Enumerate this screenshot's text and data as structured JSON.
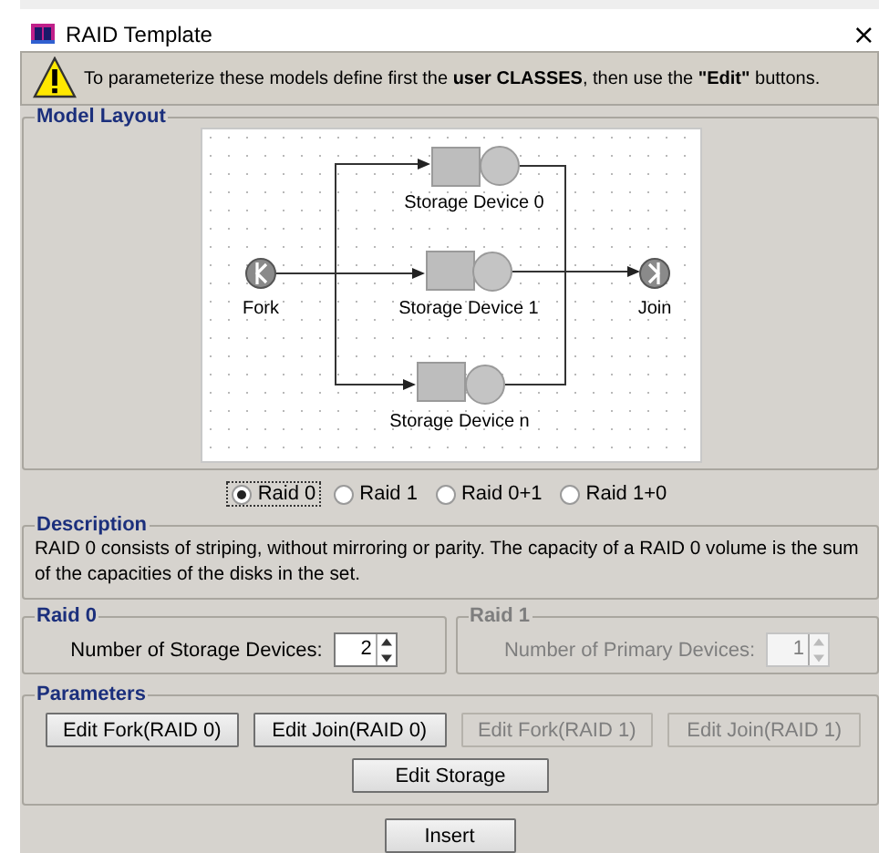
{
  "window": {
    "title": "RAID Template",
    "close": "×"
  },
  "notice": {
    "text": "To parameterize these models define first the **user CLASSES**, then use the **\"Edit\"** buttons."
  },
  "model_layout": {
    "title": "Model Layout",
    "nodes": [
      {
        "kind": "fork",
        "label": "Fork"
      },
      {
        "kind": "device",
        "label": "Storage Device 0"
      },
      {
        "kind": "device",
        "label": "Storage Device 1"
      },
      {
        "kind": "device",
        "label": "Storage Device n"
      },
      {
        "kind": "join",
        "label": "Join"
      }
    ]
  },
  "raid_options": [
    {
      "label": "Raid 0",
      "selected": true
    },
    {
      "label": "Raid 1",
      "selected": false
    },
    {
      "label": "Raid 0+1",
      "selected": false
    },
    {
      "label": "Raid 1+0",
      "selected": false
    }
  ],
  "description": {
    "title": "Description",
    "text": "RAID 0 consists of striping, without mirroring or parity. The capacity of a RAID 0 volume is the sum of the capacities of the disks in the set."
  },
  "raid_panels": [
    {
      "title": "Raid 0",
      "label": "Number of Storage Devices:",
      "value": "2",
      "disabled": false
    },
    {
      "title": "Raid 1",
      "label": "Number of Primary Devices:",
      "value": "1",
      "disabled": true
    }
  ],
  "parameters": {
    "title": "Parameters",
    "buttons": [
      {
        "label": "Edit Fork(RAID 0)",
        "disabled": false
      },
      {
        "label": "Edit Join(RAID 0)",
        "disabled": false
      },
      {
        "label": "Edit Fork(RAID 1)",
        "disabled": true
      },
      {
        "label": "Edit Join(RAID 1)",
        "disabled": true
      }
    ],
    "storage_button": {
      "label": "Edit Storage",
      "disabled": false
    }
  },
  "insert_button": {
    "label": "Insert"
  }
}
